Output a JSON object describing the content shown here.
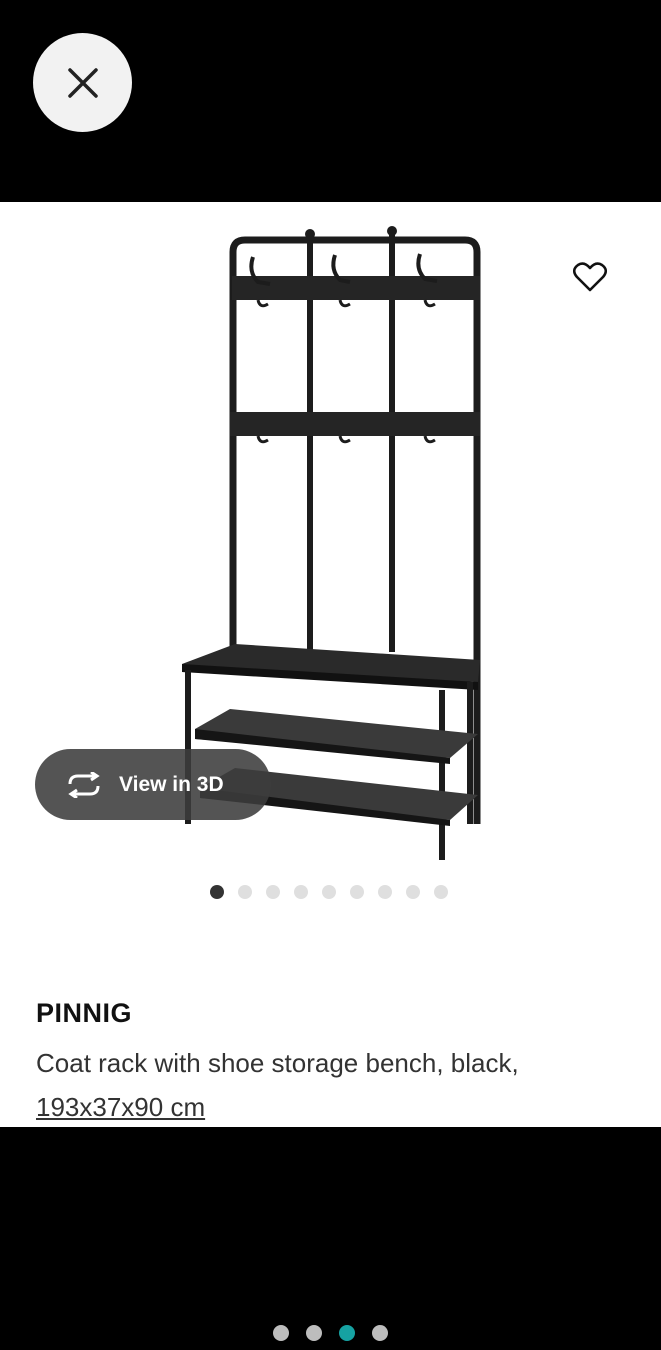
{
  "colors": {
    "background": "#000000",
    "card": "#ffffff",
    "page_dot_active": "#16a2a2",
    "page_dot": "#bdbdbd",
    "carousel_dot_active": "#333333",
    "carousel_dot": "#dfdfdf"
  },
  "icons": {
    "close": "close-icon",
    "favorite": "heart-icon",
    "view_3d": "rotate-3d-icon"
  },
  "viewer": {
    "view_3d_label": "View in 3D",
    "carousel": {
      "count": 9,
      "active_index": 0
    }
  },
  "product": {
    "name": "PINNIG",
    "description": "Coat rack with shoe storage bench, black,",
    "dimensions": "193x37x90 cm"
  },
  "pager": {
    "count": 4,
    "active_index": 2
  }
}
